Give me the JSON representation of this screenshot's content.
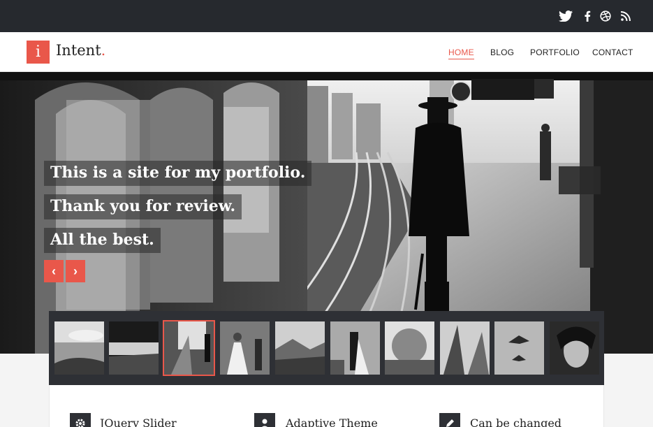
{
  "topbar": {
    "social": [
      {
        "icon": "twitter-icon"
      },
      {
        "icon": "facebook-icon"
      },
      {
        "icon": "dribbble-icon"
      },
      {
        "icon": "rss-icon"
      }
    ]
  },
  "header": {
    "logo_letter": "i",
    "logo_name": "Intent",
    "logo_dot": ".",
    "nav": [
      {
        "label": "HOME",
        "active": true
      },
      {
        "label": "BLOG",
        "active": false
      },
      {
        "label": "PORTFOLIO",
        "active": false
      },
      {
        "label": "CONTACT",
        "active": false
      }
    ]
  },
  "hero": {
    "captions": [
      "This is a site for my portfolio.",
      "Thank you for review.",
      "All the best."
    ],
    "prev_label": "‹",
    "next_label": "›"
  },
  "thumbnails": {
    "active_index": 2,
    "count": 10
  },
  "features": [
    {
      "title": "JQuery Slider",
      "icon": "gear-icon"
    },
    {
      "title": "Adaptive Theme",
      "icon": "user-icon"
    },
    {
      "title": "Can be changed",
      "icon": "pencil-icon"
    }
  ],
  "colors": {
    "accent": "#e9574a",
    "dark": "#26292e"
  }
}
